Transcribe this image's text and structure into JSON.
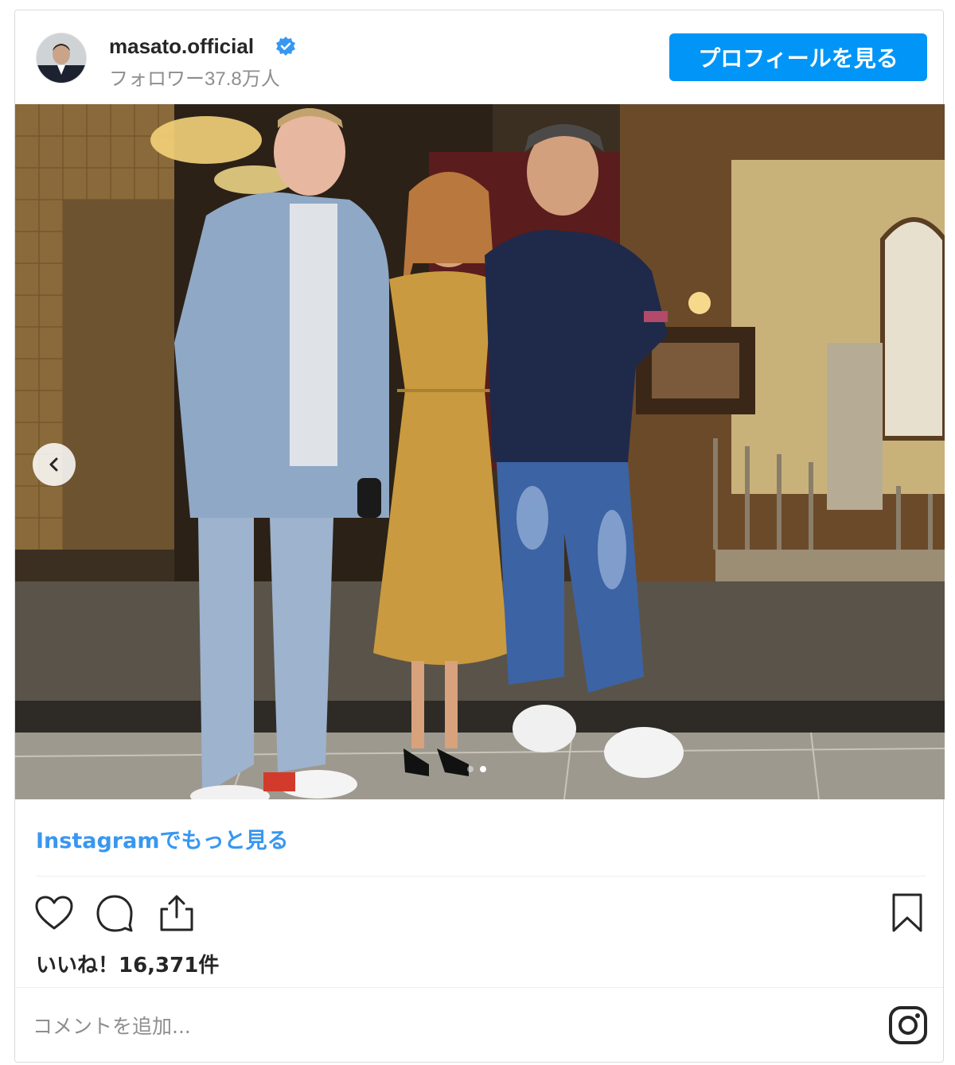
{
  "post": {
    "username": "masato.official",
    "followers": "フォロワー37.8万人",
    "profile_button": "プロフィールを見る",
    "more_link": "Instagramでもっと見る",
    "likes": "いいね！16,371件",
    "comment_placeholder": "コメントを追加...",
    "carousel": {
      "total_slides": 2,
      "current_slide": 2
    }
  },
  "icons": [
    "verified-badge-icon",
    "chevron-left-icon",
    "heart-icon",
    "comment-icon",
    "share-icon",
    "bookmark-icon",
    "instagram-icon"
  ],
  "colors": {
    "accent": "#0095f6",
    "link": "#3897f0",
    "text": "#262626",
    "muted": "#8e8e8e"
  }
}
